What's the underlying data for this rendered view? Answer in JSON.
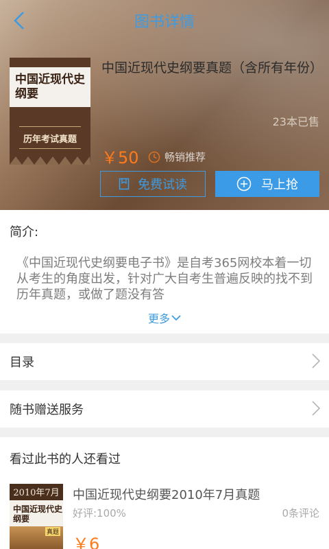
{
  "header": {
    "title": "图书详情"
  },
  "book": {
    "title": "中国近现代史纲要真题（含所有年份）",
    "cover_title": "中国近现代史纲要",
    "cover_subtitle": "历年考试真题",
    "sold": "23本已售",
    "price": "￥50",
    "hot_tag": "畅销推荐"
  },
  "actions": {
    "trial_label": "免费试读",
    "buy_label": "马上抢"
  },
  "intro": {
    "heading": "简介:",
    "text": "《中国近现代史纲要电子书》是自考365网校本着一切从考生的角度出发，针对广大自考生普遍反映的找不到历年真题，或做了题没有答",
    "more": "更多"
  },
  "rows": {
    "toc": "目录",
    "service": "随书赠送服务"
  },
  "similar": {
    "heading": "看过此书的人还看过",
    "items": [
      {
        "cover_date": "2010年7月",
        "cover_title": "中国近现代史纲要",
        "cover_tag": "真题",
        "title": "中国近现代史纲要2010年7月真题",
        "rating": "好评:100%",
        "comments": "0条评论",
        "price": "￥6"
      }
    ]
  },
  "colors": {
    "accent": "#3d9be3",
    "price": "#ff7a1a"
  }
}
